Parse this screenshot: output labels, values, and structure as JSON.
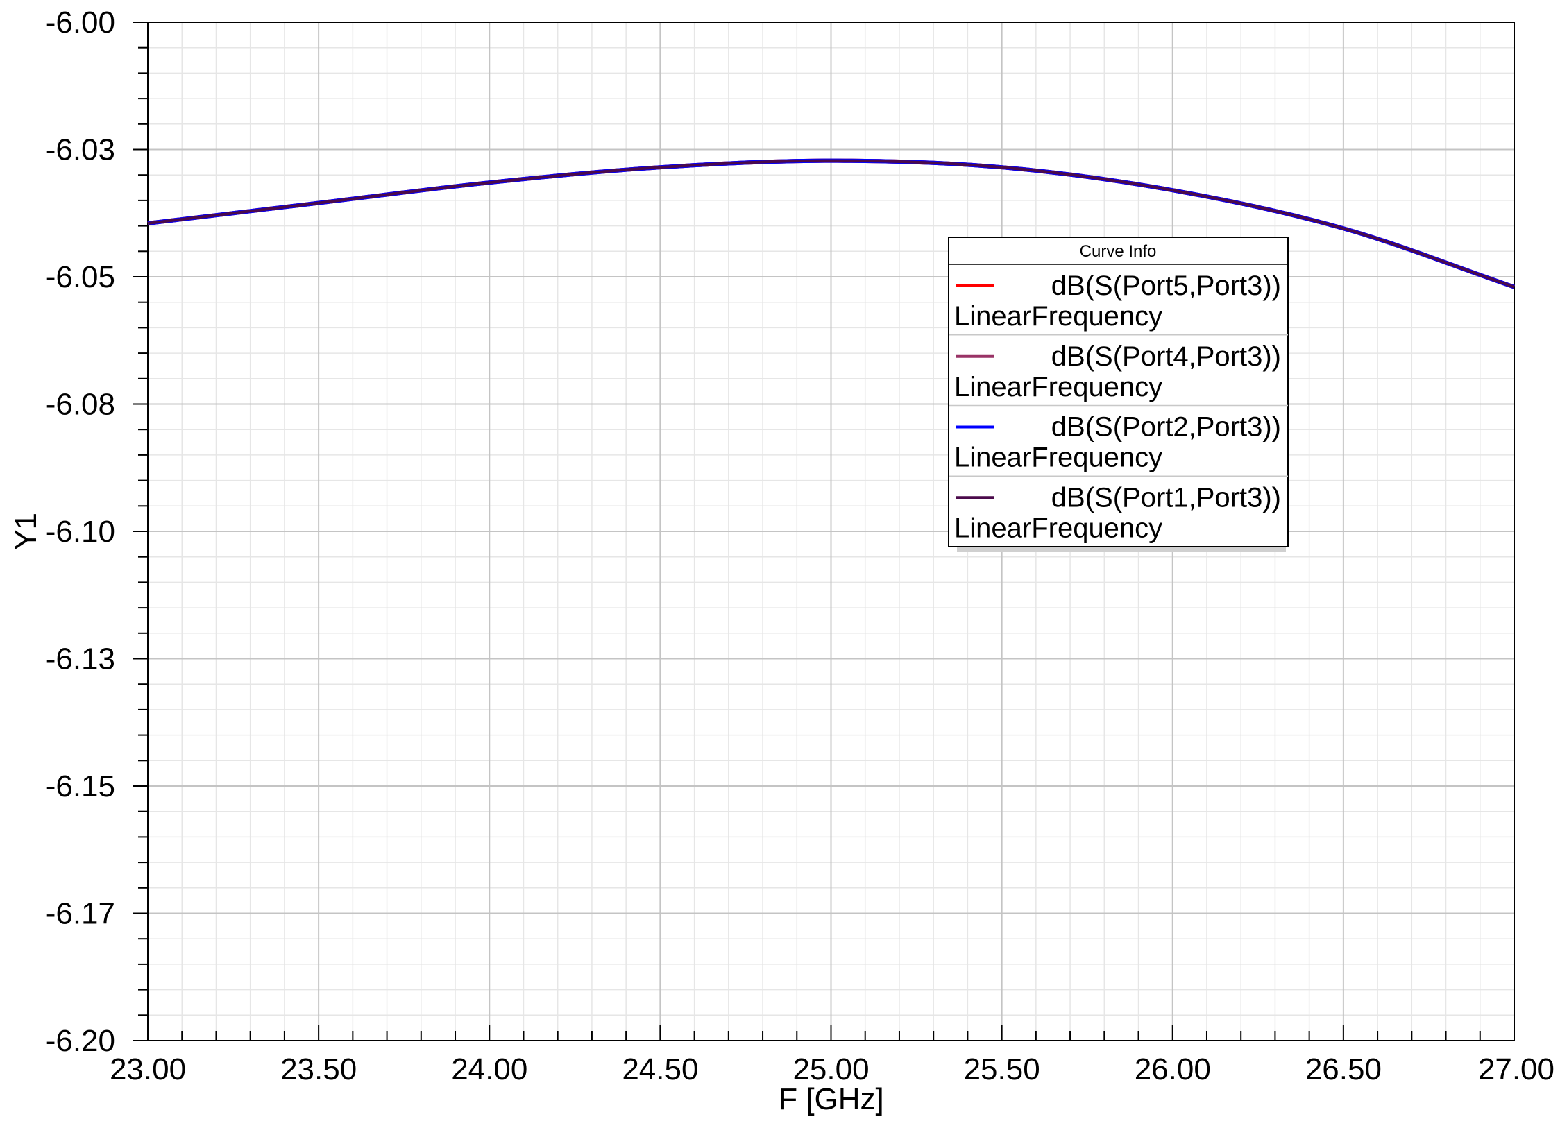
{
  "chart_data": {
    "type": "line",
    "title": "",
    "xlabel": "F [GHz]",
    "ylabel": "Y1",
    "xlim": [
      23.0,
      27.0
    ],
    "ylim": [
      -6.2,
      -6.0
    ],
    "xticks": [
      "23.00",
      "23.50",
      "24.00",
      "24.50",
      "25.00",
      "25.50",
      "26.00",
      "26.50",
      "27.00"
    ],
    "yticks": [
      "-6.00",
      "-6.03",
      "-6.05",
      "-6.08",
      "-6.10",
      "-6.13",
      "-6.15",
      "-6.17",
      "-6.20"
    ],
    "grid": true,
    "legend_title": "Curve Info",
    "legend_position": "center-right",
    "series": [
      {
        "name": "dB(S(Port5,Port3))",
        "subtitle": "LinearFrequency",
        "color": "#ff0000",
        "x": [
          23.0,
          23.5,
          24.0,
          24.5,
          25.0,
          25.5,
          26.0,
          26.5,
          27.0
        ],
        "y": [
          -6.0395,
          -6.0355,
          -6.0315,
          -6.0285,
          -6.0272,
          -6.0285,
          -6.033,
          -6.0405,
          -6.052
        ]
      },
      {
        "name": "dB(S(Port4,Port3))",
        "subtitle": "LinearFrequency",
        "color": "#993366",
        "x": [
          23.0,
          23.5,
          24.0,
          24.5,
          25.0,
          25.5,
          26.0,
          26.5,
          27.0
        ],
        "y": [
          -6.0395,
          -6.0355,
          -6.0315,
          -6.0285,
          -6.0272,
          -6.0285,
          -6.033,
          -6.0405,
          -6.052
        ]
      },
      {
        "name": "dB(S(Port2,Port3))",
        "subtitle": "LinearFrequency",
        "color": "#0000ff",
        "x": [
          23.0,
          23.5,
          24.0,
          24.5,
          25.0,
          25.5,
          26.0,
          26.5,
          27.0
        ],
        "y": [
          -6.0395,
          -6.0355,
          -6.0315,
          -6.0285,
          -6.0272,
          -6.0285,
          -6.033,
          -6.0405,
          -6.052
        ]
      },
      {
        "name": "dB(S(Port1,Port3))",
        "subtitle": "LinearFrequency",
        "color": "#4b0a4b",
        "x": [
          23.0,
          23.5,
          24.0,
          24.5,
          25.0,
          25.5,
          26.0,
          26.5,
          27.0
        ],
        "y": [
          -6.0395,
          -6.0355,
          -6.0315,
          -6.0285,
          -6.0272,
          -6.0285,
          -6.033,
          -6.0405,
          -6.052
        ]
      }
    ]
  }
}
